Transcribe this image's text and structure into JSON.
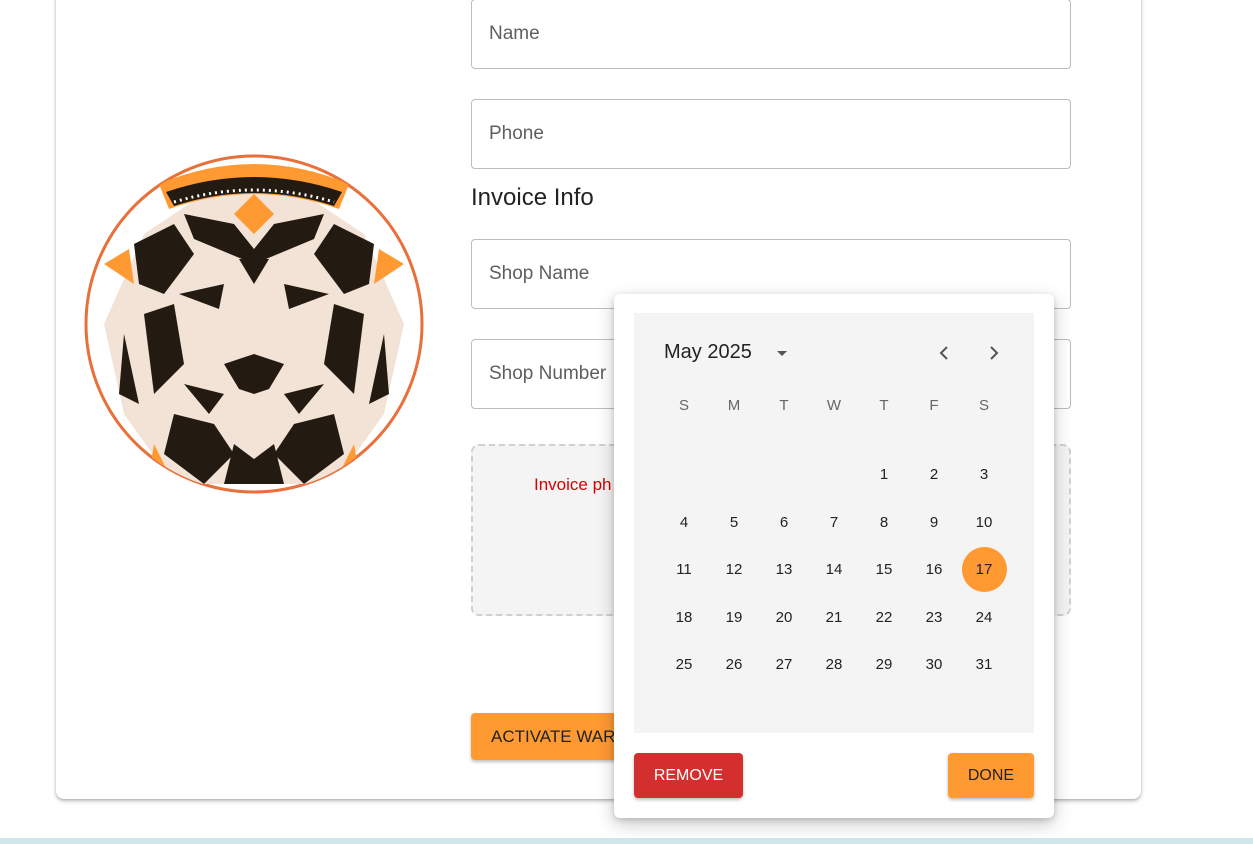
{
  "form": {
    "name_placeholder": "Name",
    "phone_placeholder": "Phone",
    "invoice_section_title": "Invoice Info",
    "shop_name_placeholder": "Shop Name",
    "shop_number_placeholder": "Shop Number",
    "invoice_photo_error": "Invoice ph",
    "activate_button": "ACTIVATE WARR"
  },
  "logo": {
    "icon": "lion-logo",
    "accent_color": "#ff9a33",
    "dark_color": "#231b12",
    "light_color": "#f2e3d6"
  },
  "datepicker": {
    "month_label": "May 2025",
    "weekdays": [
      "S",
      "M",
      "T",
      "W",
      "T",
      "F",
      "S"
    ],
    "weeks": [
      [
        "",
        "",
        "",
        "",
        "1",
        "2",
        "3"
      ],
      [
        "4",
        "5",
        "6",
        "7",
        "8",
        "9",
        "10"
      ],
      [
        "11",
        "12",
        "13",
        "14",
        "15",
        "16",
        "17"
      ],
      [
        "18",
        "19",
        "20",
        "21",
        "22",
        "23",
        "24"
      ],
      [
        "25",
        "26",
        "27",
        "28",
        "29",
        "30",
        "31"
      ]
    ],
    "selected_day": "17",
    "remove_button": "REMOVE",
    "done_button": "DONE"
  },
  "colors": {
    "accent": "#ff9a33",
    "danger": "#d32f2f",
    "error_text": "#d50000"
  }
}
